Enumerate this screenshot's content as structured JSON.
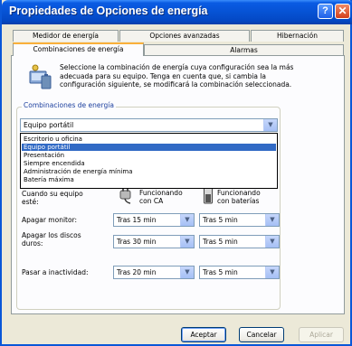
{
  "window": {
    "title": "Propiedades de Opciones de energía",
    "help_label": "?",
    "close_label": "✕"
  },
  "tabs": {
    "row_back": [
      "Medidor de energía",
      "Opciones avanzadas",
      "Hibernación"
    ],
    "row_front": [
      "Combinaciones de energía",
      "Alarmas"
    ]
  },
  "description": "Seleccione la combinación de energía cuya configuración sea la más adecuada para su equipo. Tenga en cuenta que, si cambia la configuración siguiente, se modificará la combinación seleccionada.",
  "schemes": {
    "legend": "Combinaciones de energía",
    "selected": "Equipo portátil",
    "options": [
      "Escritorio u oficina",
      "Equipo portátil",
      "Presentación",
      "Siempre encendida",
      "Administración de energía mínima",
      "Batería máxima"
    ],
    "highlighted_index": 1
  },
  "settings": {
    "header_label": "Cuando su equipo esté:",
    "ac_header": "Funcionando con CA",
    "battery_header": "Funcionando con baterías",
    "rows": [
      {
        "label": "Apagar monitor:",
        "ac": "Tras 15 min",
        "battery": "Tras 5 min"
      },
      {
        "label": "Apagar los discos duros:",
        "ac": "Tras 30 min",
        "battery": "Tras 5 min"
      },
      {
        "label": "Pasar a inactividad:",
        "ac": "Tras 20 min",
        "battery": "Tras 5 min"
      }
    ]
  },
  "buttons": {
    "accept": "Aceptar",
    "cancel": "Cancelar",
    "apply": "Aplicar"
  },
  "icons": {
    "combo_arrow": "chevron-down-icon",
    "power_scheme": "power-options-icon",
    "plug": "ac-plug-icon",
    "battery": "battery-icon"
  },
  "colors": {
    "title_bar": "#0652d4",
    "selection": "#316ac5",
    "close_button": "#d3401c",
    "tab_highlight": "#f9b03b"
  }
}
